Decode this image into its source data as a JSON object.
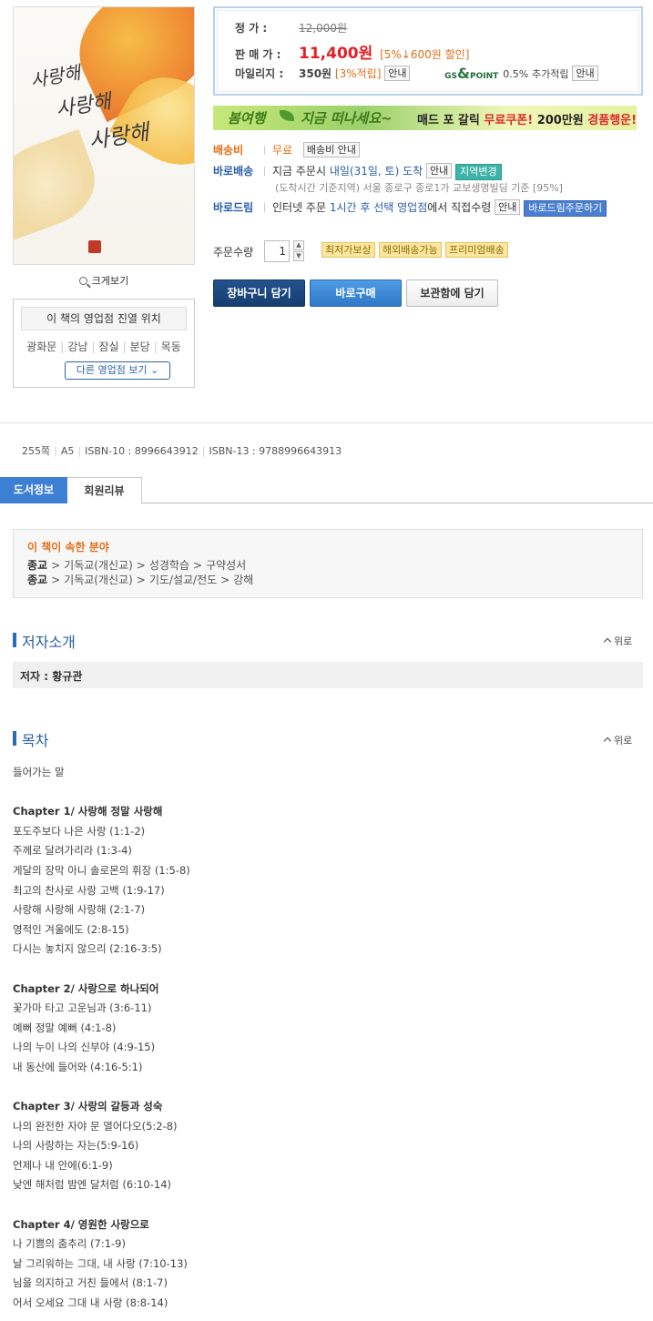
{
  "cover": {
    "title_line1": "사랑해",
    "title_line2": "사랑해",
    "title_line3": "사랑해",
    "zoom_label": "크게보기"
  },
  "store": {
    "title": "이 책의 영업점 진열 위치",
    "locations": [
      "광화문",
      "강남",
      "잠실",
      "분당",
      "목동"
    ],
    "more_label": "다른 영업점 보기"
  },
  "price": {
    "list_label": "정      가 :",
    "list_price": "12,000원",
    "sale_label": "판 매 가 :",
    "sale_price": "11,400원",
    "discount": "[5%↓600원 할인]",
    "mileage_label": "마일리지 :",
    "mileage_value": "350원",
    "mileage_rate": "[3%적립]",
    "mileage_info": "안내",
    "gs_logo_top": "GS",
    "gs_logo_point": "POINT",
    "gs_rate": "0.5%",
    "gs_text": "추가적립",
    "gs_info": "안내"
  },
  "banner": {
    "text1": "봄여행",
    "text2": "지금 떠나세요~",
    "text3_prefix": "매드 포 갈릭",
    "text3_red1": "무료쿠폰!",
    "text3_mid": "200만원",
    "text3_red2": "경품행운!"
  },
  "delivery": {
    "fee_label": "배송비",
    "fee_value": "무료",
    "fee_info": "배송비 안내",
    "direct_label": "바로배송",
    "direct_text": "지금 주문시",
    "direct_date": "내일(31일, 토) 도착",
    "direct_info": "안내",
    "region_button": "지역변경",
    "direct_note": "(도착시간 기준지역) 서울 종로구 종로1가 교보생명빌딩 기준 [95%]",
    "drop_label": "바로드림",
    "drop_text1": "인터넷 주문",
    "drop_text2": "1시간 후 선택 영업점",
    "drop_text3": "에서 직접수령",
    "drop_info": "안내",
    "drop_button": "바로드림주문하기"
  },
  "order": {
    "qty_label": "주문수량",
    "qty_value": "1",
    "tags": [
      "최저가보상",
      "해외배송가능",
      "프리미엄배송"
    ]
  },
  "actions": {
    "cart": "장바구니 담기",
    "buy": "바로구매",
    "keep": "보관함에 담기"
  },
  "meta": {
    "pages": "255쪽",
    "size": "A5",
    "isbn10": "ISBN-10 : 8996643912",
    "isbn13": "ISBN-13 : 9788996643913"
  },
  "tabs": {
    "info": "도서정보",
    "review": "회원리뷰"
  },
  "category": {
    "title": "이 책이 속한 분야",
    "paths": [
      [
        "종교",
        "기독교(개신교)",
        "성경학습",
        "구약성서"
      ],
      [
        "종교",
        "기독교(개신교)",
        "기도/설교/전도",
        "강해"
      ]
    ]
  },
  "author_section": {
    "title": "저자소개",
    "top_label": "위로",
    "author": "저자 : 황규관"
  },
  "toc_section": {
    "title": "목차",
    "top_label": "위로",
    "lines": [
      {
        "t": "들어가는 말",
        "chap": false
      },
      {
        "t": "",
        "chap": false
      },
      {
        "t": "Chapter 1/ 사랑해 정말 사랑해",
        "chap": true
      },
      {
        "t": "포도주보다 나은 사랑 (1:1-2)",
        "chap": false
      },
      {
        "t": "주께로 달려가리라 (1:3-4)",
        "chap": false
      },
      {
        "t": "게달의 장막 아니 솔로몬의 휘장 (1:5-8)",
        "chap": false
      },
      {
        "t": "최고의 찬사로 사랑 고백 (1:9-17)",
        "chap": false
      },
      {
        "t": "사랑해 사랑해 사랑해 (2:1-7)",
        "chap": false
      },
      {
        "t": "영적인 겨울에도 (2:8-15)",
        "chap": false
      },
      {
        "t": "다시는 놓치지 않으리 (2:16-3:5)",
        "chap": false
      },
      {
        "t": "",
        "chap": false
      },
      {
        "t": "Chapter 2/ 사랑으로 하나되어",
        "chap": true
      },
      {
        "t": "꽃가마 타고 고운님과 (3:6-11)",
        "chap": false
      },
      {
        "t": "예뻐 정말 예뻐 (4:1-8)",
        "chap": false
      },
      {
        "t": "나의 누이 나의 신부야 (4:9-15)",
        "chap": false
      },
      {
        "t": "내 동산에 들어와 (4:16-5:1)",
        "chap": false
      },
      {
        "t": "",
        "chap": false
      },
      {
        "t": "Chapter 3/ 사랑의 갈등과 성숙",
        "chap": true
      },
      {
        "t": "나의 완전한 자야 문 열어다오(5:2-8)",
        "chap": false
      },
      {
        "t": "나의 사랑하는 자는(5:9-16)",
        "chap": false
      },
      {
        "t": "언제나 내 안에(6:1-9)",
        "chap": false
      },
      {
        "t": "낮엔 해처럼 밤엔 달처럼 (6:10-14)",
        "chap": false
      },
      {
        "t": "",
        "chap": false
      },
      {
        "t": "Chapter 4/ 영원한 사랑으로",
        "chap": true
      },
      {
        "t": "나 기쁨의 춤추리 (7:1-9)",
        "chap": false
      },
      {
        "t": "날 그리워하는 그대, 내 사랑 (7:10-13)",
        "chap": false
      },
      {
        "t": "님을 의지하고 거친 들에서 (8:1-7)",
        "chap": false
      },
      {
        "t": "어서 오세요 그대 내 사랑 (8:8-14)",
        "chap": false
      }
    ]
  }
}
